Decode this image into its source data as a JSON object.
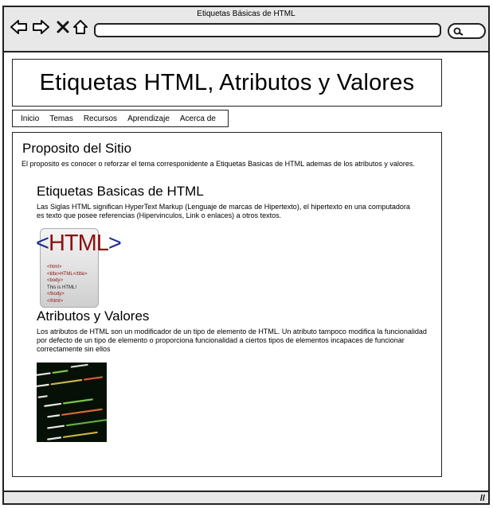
{
  "window": {
    "title": "Etiquetas Básicas de HTML"
  },
  "toolbar": {
    "icons": [
      "back-arrow-icon",
      "forward-arrow-icon",
      "close-icon",
      "home-icon",
      "search-icon"
    ]
  },
  "page": {
    "header_title": "Etiquetas HTML, Atributos y Valores",
    "menu": [
      "Inicio",
      "Temas",
      "Recursos",
      "Aprendizaje",
      "Acerca de"
    ],
    "main": {
      "title": "Proposito del Sitio",
      "text": "El proposito es conocer o reforzar el tema corresponidente a Etiquetas Basicas de HTML ademas de los atributos y valores.",
      "section1": {
        "title": "Etiquetas Basicas de HTML",
        "text": "Las Siglas HTML significan HyperText Markup (Lenguaje de marcas de Hipertexto), el hipertexto en una computadora es texto que posee referencias (Hipervinculos, Link o enlaces) a otros textos.",
        "image": {
          "big_text": "HTML",
          "code_lines": [
            "<html>",
            "<title>HTML</title>",
            "<body>",
            "This is HTML!",
            "</body>",
            "</html>"
          ]
        }
      },
      "section2": {
        "title": "Atributos y Valores",
        "text": "Los atributos de HTML son un modificador de un tipo de elemento de HTML. Un atributo tampoco modifica la funcionalidad por defecto de un tipo de elemento o proporciona funcionalidad a ciertos tipos de elementos incapaces de funcionar correctamente sin ellos"
      }
    }
  }
}
